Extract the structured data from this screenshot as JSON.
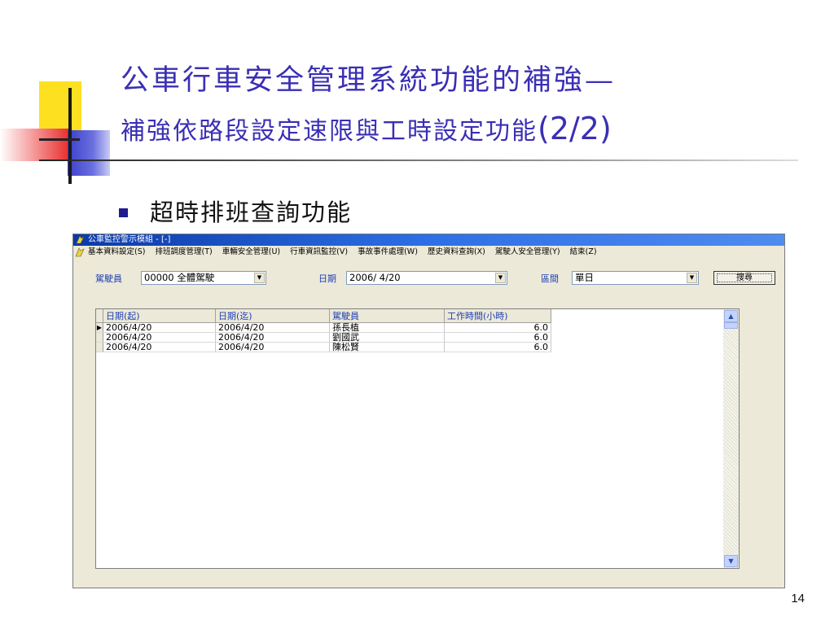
{
  "slide": {
    "title_line1": "公車行車安全管理系統功能的補強—",
    "title_line2": "補強依路段設定速限與工時設定功能",
    "title_line2_suffix": "(2/2)",
    "bullet": "超時排班查詢功能",
    "page_number": "14"
  },
  "window": {
    "title": "公車監控警示模組 - [-]",
    "menu": [
      "基本資料設定(S)",
      "排班調度管理(T)",
      "車輛安全管理(U)",
      "行車資訊監控(V)",
      "事故事件處理(W)",
      "歷史資料查詢(X)",
      "駕駛人安全管理(Y)",
      "結束(Z)"
    ],
    "filters": {
      "driver_label": "駕駛員",
      "driver_value": "00000 全體駕駛",
      "date_label": "日期",
      "date_value": "2006/ 4/20",
      "interval_label": "區間",
      "interval_value": "單日",
      "search_button": "搜尋"
    },
    "grid": {
      "columns": [
        "日期(起)",
        "日期(迄)",
        "駕駛員",
        "工作時間(小時)"
      ],
      "rows": [
        [
          "2006/4/20",
          "2006/4/20",
          "孫長植",
          "6.0"
        ],
        [
          "2006/4/20",
          "2006/4/20",
          "劉國武",
          "6.0"
        ],
        [
          "2006/4/20",
          "2006/4/20",
          "陳松賢",
          "6.0"
        ]
      ]
    }
  }
}
